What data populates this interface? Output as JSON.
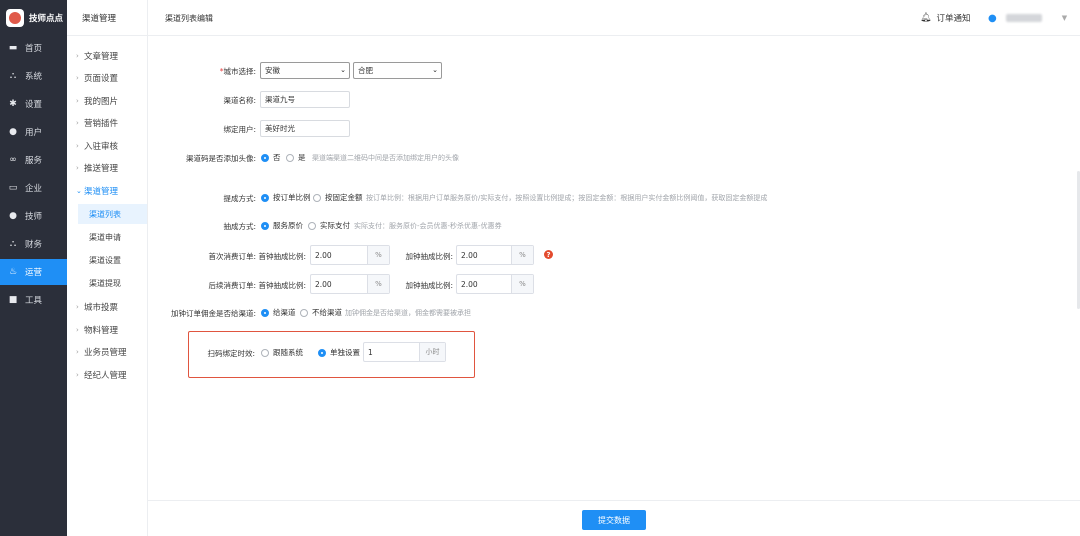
{
  "brand": {
    "name": "技师点点"
  },
  "nav": [
    {
      "label": "首页",
      "icon": "monitor-icon"
    },
    {
      "label": "系统",
      "icon": "sitemap-icon"
    },
    {
      "label": "设置",
      "icon": "gear-icon"
    },
    {
      "label": "用户",
      "icon": "user-icon"
    },
    {
      "label": "服务",
      "icon": "link-icon"
    },
    {
      "label": "企业",
      "icon": "building-icon"
    },
    {
      "label": "技师",
      "icon": "person-icon"
    },
    {
      "label": "财务",
      "icon": "network-icon"
    },
    {
      "label": "运营",
      "icon": "chart-icon"
    },
    {
      "label": "工具",
      "icon": "toolbox-icon"
    }
  ],
  "subnav": {
    "title": "渠道管理",
    "items": [
      "文章管理",
      "页面设置",
      "我的图片",
      "营销插件",
      "入驻审核",
      "推送管理",
      "渠道管理"
    ],
    "children": [
      "渠道列表",
      "渠道申请",
      "渠道设置",
      "渠道提现"
    ],
    "after": [
      "城市投票",
      "物料管理",
      "业务员管理",
      "经纪人管理"
    ]
  },
  "header": {
    "title": "渠道列表编辑",
    "notice": "订单通知"
  },
  "form": {
    "city_label": "城市选择:",
    "province": "安徽",
    "city": "合肥",
    "name_label": "渠道名称:",
    "name_value": "渠道九号",
    "bind_label": "绑定用户:",
    "bind_value": "美好时光",
    "avatar_label": "渠道码是否添加头像:",
    "avatar_no": "否",
    "avatar_yes": "是",
    "avatar_hint": "渠道端渠道二维码中间是否添加绑定用户的头像",
    "commission_label": "提成方式:",
    "commission_opt1": "按订单比例",
    "commission_opt2": "按固定金额",
    "commission_hint": "按订单比例：根据用户订单服务原价/实际支付，按照设置比例提成；按固定金额：根据用户实付金额比例阈值，获取固定金额提成",
    "base_label": "抽成方式:",
    "base_opt1": "服务原价",
    "base_opt2": "实际支付",
    "base_hint": "实际支付：服务原价-会员优惠-秒杀优惠-优惠券",
    "first_label": "首次消费订单:",
    "first_pct_label": "首钟抽成比例:",
    "first_pct": "2.00",
    "first_add_label": "加钟抽成比例:",
    "first_add": "2.00",
    "next_label": "后续消费订单:",
    "next_pct_label": "首钟抽成比例:",
    "next_pct": "2.00",
    "next_add_label": "加钟抽成比例:",
    "next_add": "2.00",
    "unit_pct": "%",
    "help_mark": "?",
    "addon_label": "加钟订单佣金是否给渠道:",
    "addon_opt1": "给渠道",
    "addon_opt2": "不给渠道",
    "addon_hint": "加钟佣金是否给渠道，佣金都需要被承担",
    "scan_label": "扫码绑定时效:",
    "scan_opt1": "跟随系统",
    "scan_opt2": "单独设置",
    "scan_value": "1",
    "scan_unit": "小时"
  },
  "footer": {
    "submit": "提交数据"
  },
  "colors": {
    "accent": "#1f8ff5",
    "sidebar": "#2b2f3a",
    "highlight": "#e0553f"
  }
}
